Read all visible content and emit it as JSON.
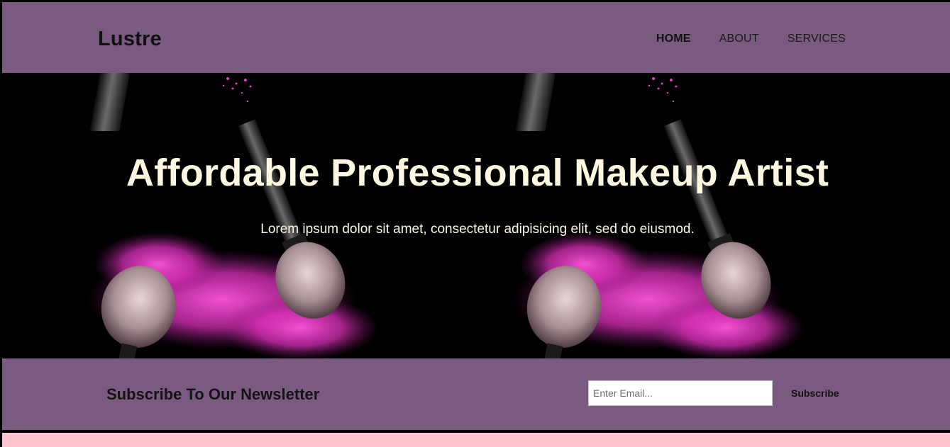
{
  "header": {
    "logo": "Lustre",
    "nav": [
      {
        "label": "HOME",
        "active": true
      },
      {
        "label": "ABOUT",
        "active": false
      },
      {
        "label": "SERVICES",
        "active": false
      }
    ]
  },
  "hero": {
    "title": "Affordable Professional Makeup Artist",
    "subtitle": "Lorem ipsum dolor sit amet, consectetur adipisicing elit, sed do eiusmod."
  },
  "newsletter": {
    "title": "Subscribe To Our Newsletter",
    "email_placeholder": "Enter Email...",
    "subscribe_label": "Subscribe"
  },
  "colors": {
    "header_bg": "#7a5a80",
    "hero_bg": "#000000",
    "hero_text": "#fff8e1",
    "powder_pink": "#e040c8",
    "footer_strip": "#ffc4cf"
  }
}
